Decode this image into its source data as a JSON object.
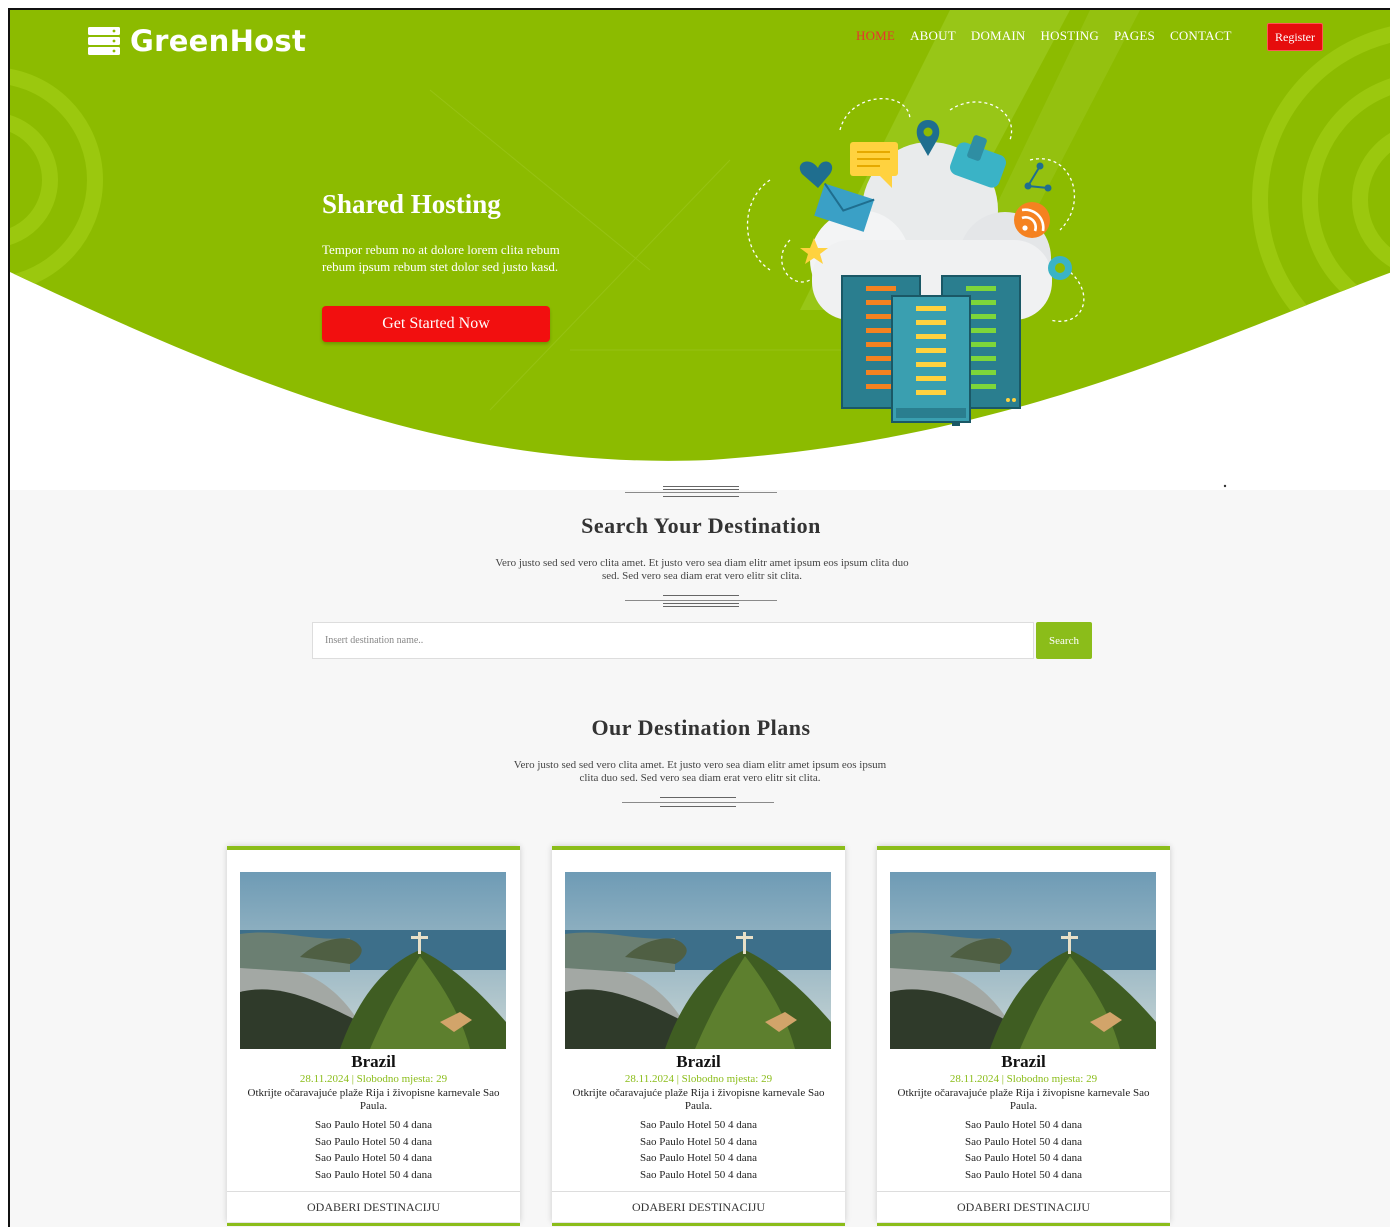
{
  "brand": {
    "name": "GreenHost"
  },
  "nav": {
    "items": [
      {
        "label": "HOME",
        "active": true
      },
      {
        "label": "ABOUT"
      },
      {
        "label": "DOMAIN"
      },
      {
        "label": "HOSTING"
      },
      {
        "label": "PAGES"
      },
      {
        "label": "CONTACT"
      }
    ],
    "register_label": "Register"
  },
  "hero": {
    "title": "Shared Hosting",
    "text": "Tempor rebum no at dolore lorem clita rebum rebum ipsum rebum stet dolor sed justo kasd.",
    "cta_label": "Get Started Now"
  },
  "search_section": {
    "title": "Search Your Destination",
    "text": "Vero justo sed sed vero clita amet. Et justo vero sea diam elitr amet ipsum eos ipsum clita duo sed. Sed vero sea diam erat vero elitr sit clita.",
    "placeholder": "Insert destination name..",
    "button_label": "Search"
  },
  "plans_section": {
    "title": "Our Destination Plans",
    "text": "Vero justo sed sed vero clita amet. Et justo vero sea diam elitr amet ipsum eos ipsum clita duo sed. Sed vero sea diam erat vero elitr sit clita."
  },
  "cards": [
    {
      "name": "Brazil",
      "meta": "28.11.2024 | Slobodno mjesta: 29",
      "description": "Otkrijte očaravajuće plaže Rija i živopisne karnevale Sao Paula.",
      "items": [
        "Sao Paulo Hotel 50 4 dana",
        "Sao Paulo Hotel 50 4 dana",
        "Sao Paulo Hotel 50 4 dana",
        "Sao Paulo Hotel 50 4 dana"
      ],
      "action_label": "ODABERI DESTINACIJU"
    },
    {
      "name": "Brazil",
      "meta": "28.11.2024 | Slobodno mjesta: 29",
      "description": "Otkrijte očaravajuće plaže Rija i živopisne karnevale Sao Paula.",
      "items": [
        "Sao Paulo Hotel 50 4 dana",
        "Sao Paulo Hotel 50 4 dana",
        "Sao Paulo Hotel 50 4 dana",
        "Sao Paulo Hotel 50 4 dana"
      ],
      "action_label": "ODABERI DESTINACIJU"
    },
    {
      "name": "Brazil",
      "meta": "28.11.2024 | Slobodno mjesta: 29",
      "description": "Otkrijte očaravajuće plaže Rija i živopisne karnevale Sao Paula.",
      "items": [
        "Sao Paulo Hotel 50 4 dana",
        "Sao Paulo Hotel 50 4 dana",
        "Sao Paulo Hotel 50 4 dana",
        "Sao Paulo Hotel 50 4 dana"
      ],
      "action_label": "ODABERI DESTINACIJU"
    }
  ],
  "colors": {
    "brand_green": "#8bbd1a",
    "hero_green": "#8cbb00",
    "accent_red": "#f20f0f",
    "nav_active": "#e8332f"
  },
  "icons": [
    "server-logo-icon",
    "cloud-server-illustration",
    "location-pin-icon",
    "rss-icon",
    "heart-icon",
    "mail-icon",
    "star-icon",
    "chat-icon"
  ]
}
